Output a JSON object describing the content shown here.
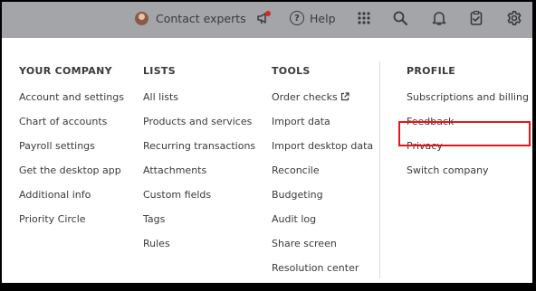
{
  "topbar": {
    "contact_label": "Contact experts",
    "help_label": "Help",
    "icons": [
      "megaphone-icon",
      "help-icon",
      "apps-grid-icon",
      "search-icon",
      "bell-icon",
      "clipboard-icon",
      "gear-icon"
    ]
  },
  "menu": {
    "columns": [
      {
        "heading": "YOUR COMPANY",
        "items": [
          "Account and settings",
          "Chart of accounts",
          "Payroll settings",
          "Get the desktop app",
          "Additional info",
          "Priority Circle"
        ]
      },
      {
        "heading": "LISTS",
        "items": [
          "All lists",
          "Products and services",
          "Recurring transactions",
          "Attachments",
          "Custom fields",
          "Tags",
          "Rules"
        ]
      },
      {
        "heading": "TOOLS",
        "items": [
          "Order checks",
          "Import data",
          "Import desktop data",
          "Reconcile",
          "Budgeting",
          "Audit log",
          "Share screen",
          "Resolution center"
        ]
      },
      {
        "heading": "PROFILE",
        "items": [
          "Subscriptions and billing",
          "Feedback",
          "Privacy",
          "Switch company"
        ]
      }
    ]
  },
  "colors": {
    "topbar_bg": "#a3a5a8",
    "text": "#393a3d",
    "highlight": "#e8141c",
    "badge": "#d52b1e"
  }
}
